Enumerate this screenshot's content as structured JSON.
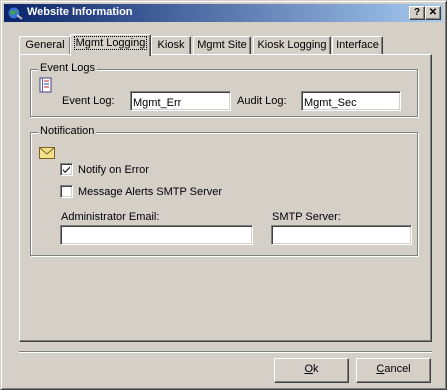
{
  "window": {
    "title": "Website Information",
    "help_label": "?",
    "close_label": "✕"
  },
  "tabs": [
    {
      "label": "General",
      "active": false
    },
    {
      "label": "Mgmt Logging",
      "active": true
    },
    {
      "label": "Kiosk",
      "active": false
    },
    {
      "label": "Mgmt Site",
      "active": false
    },
    {
      "label": "Kiosk Logging",
      "active": false
    },
    {
      "label": "Interface",
      "active": false
    }
  ],
  "event_logs": {
    "group_label": "Event Logs",
    "icon": "log-book-icon",
    "event_log_label": "Event Log:",
    "event_log_value": "Mgmt_Err",
    "audit_log_label": "Audit Log:",
    "audit_log_value": "Mgmt_Sec"
  },
  "notification": {
    "group_label": "Notification",
    "icon": "envelope-icon",
    "notify_on_error_label": "Notify on Error",
    "notify_on_error_checked": true,
    "smtp_alerts_label": "Message Alerts SMTP Server",
    "smtp_alerts_checked": false,
    "admin_email_label": "Administrator Email:",
    "admin_email_value": "",
    "smtp_server_label": "SMTP Server:",
    "smtp_server_value": ""
  },
  "buttons": {
    "ok_mnemonic": "O",
    "ok_rest": "k",
    "cancel_mnemonic": "C",
    "cancel_rest": "ancel"
  }
}
